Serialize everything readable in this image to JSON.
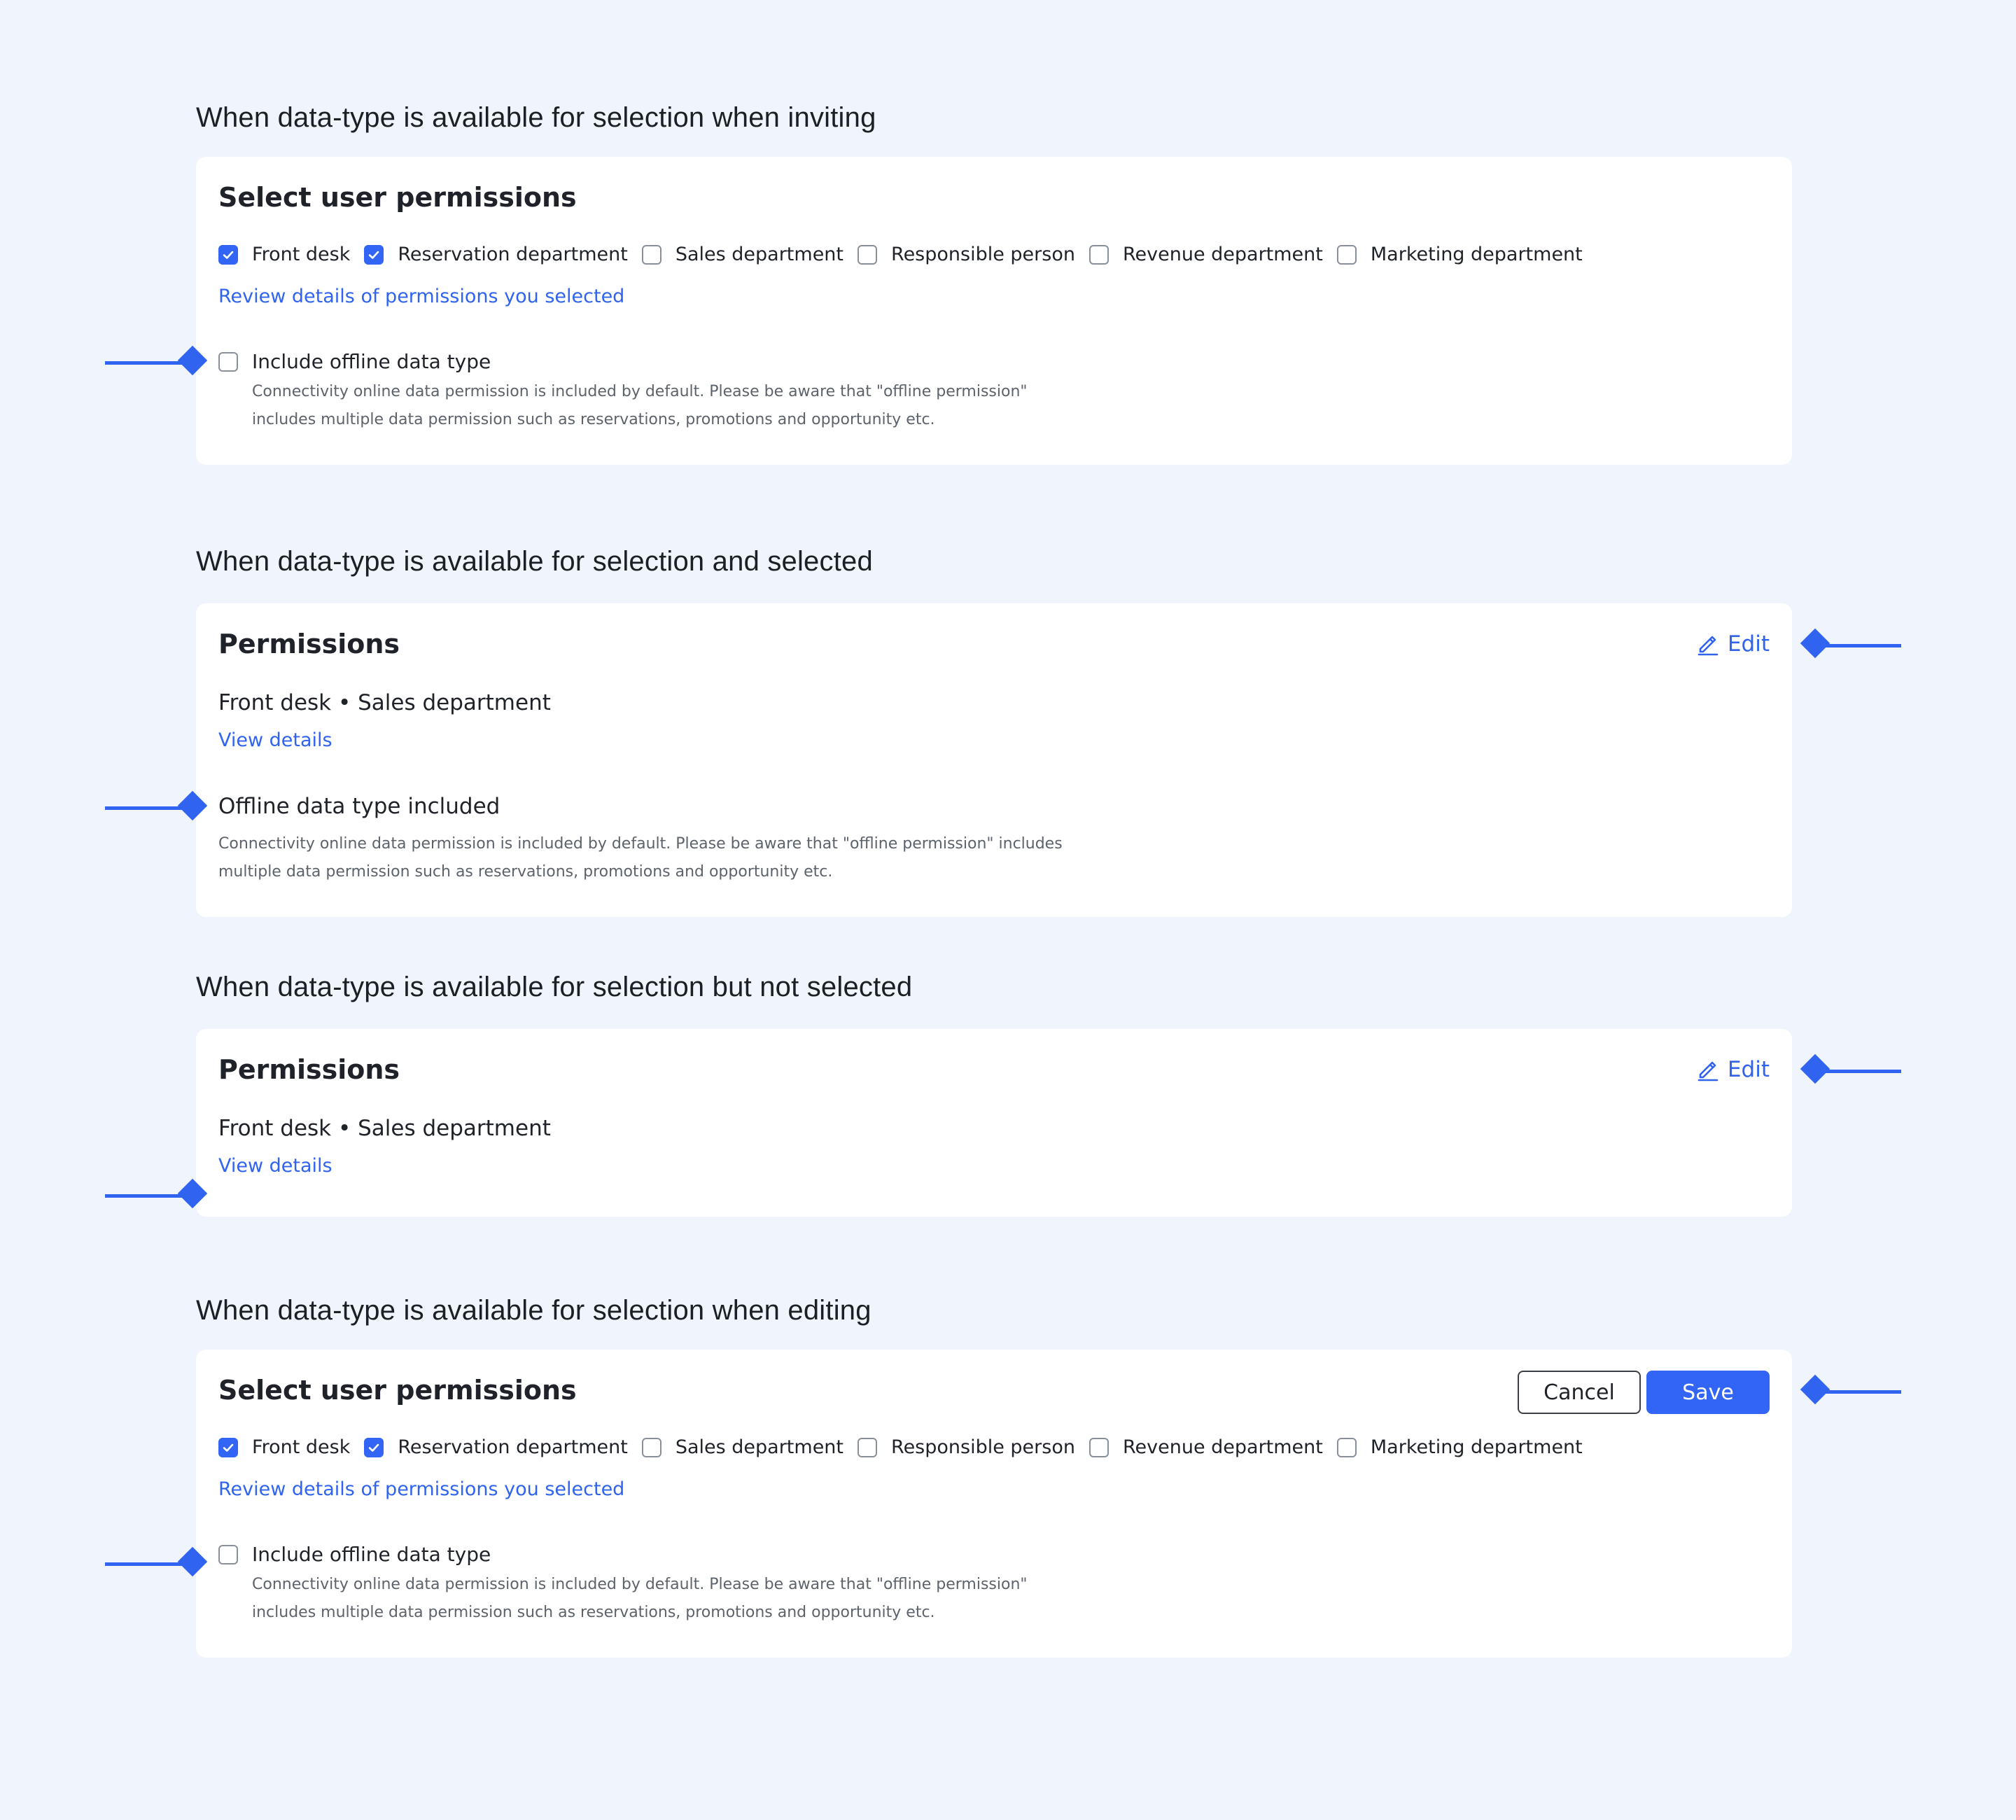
{
  "sections": [
    {
      "heading": "When data-type is available for selection when inviting",
      "card_title": "Select user permissions",
      "review_link": "Review details of permissions you selected",
      "offline_label": "Include offline data type",
      "help_line1": "Connectivity online data permission is included by default. Please be aware that \"offline permission\"",
      "help_line2": "includes multiple data permission such as reservations, promotions and opportunity etc."
    },
    {
      "heading": "When data-type is available for selection and selected",
      "card_title": "Permissions",
      "edit_label": "Edit",
      "summary": "Front desk • Sales department",
      "view_details": "View details",
      "included_title": "Offline data type included",
      "help_line1": "Connectivity online data permission is included by default. Please be aware that \"offline permission\" includes",
      "help_line2": "multiple data permission such as reservations, promotions and opportunity etc."
    },
    {
      "heading": "When data-type is available for selection but not selected",
      "card_title": "Permissions",
      "edit_label": "Edit",
      "summary": "Front desk • Sales department",
      "view_details": "View details"
    },
    {
      "heading": "When data-type is available for selection when editing",
      "card_title": "Select user permissions",
      "cancel_label": "Cancel",
      "save_label": "Save",
      "review_link": "Review details of permissions you selected",
      "offline_label": "Include offline data type",
      "help_line1": "Connectivity online data permission is included by default. Please be aware that \"offline permission\"",
      "help_line2": "includes multiple data permission such as reservations, promotions and opportunity etc."
    }
  ],
  "permissions": [
    {
      "label": "Front desk",
      "checked": true
    },
    {
      "label": "Reservation department",
      "checked": true
    },
    {
      "label": "Sales department",
      "checked": false
    },
    {
      "label": "Responsible person",
      "checked": false
    },
    {
      "label": "Revenue department",
      "checked": false
    },
    {
      "label": "Marketing department",
      "checked": false
    }
  ],
  "offline_checked": false,
  "colors": {
    "background": "#eff4fd",
    "accent": "#3265f5",
    "link": "#2f63f0",
    "card": "#ffffff",
    "marker": "#2f63f0"
  },
  "icons": {
    "edit": "pencil-icon",
    "checkbox_checked": "checkmark-icon"
  }
}
